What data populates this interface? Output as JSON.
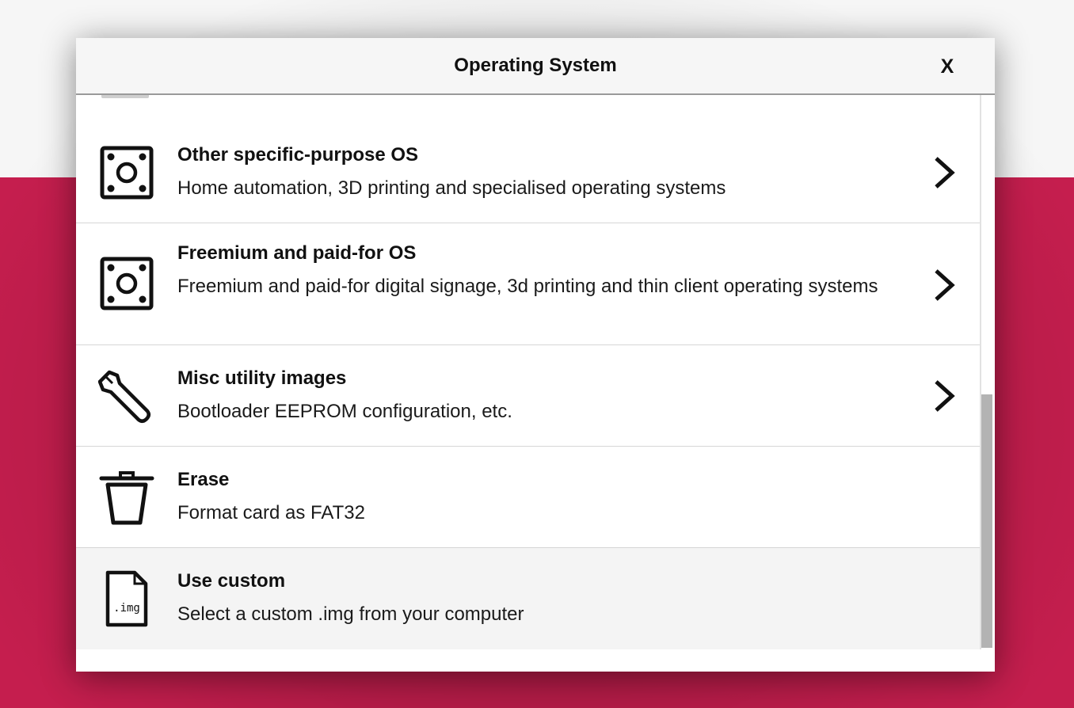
{
  "dialog": {
    "title": "Operating System",
    "close_label": "X"
  },
  "items": [
    {
      "icon": "board-icon",
      "title": "Other specific-purpose OS",
      "description": "Home automation, 3D printing and specialised operating systems",
      "has_submenu": true
    },
    {
      "icon": "board-icon",
      "title": "Freemium and paid-for OS",
      "description": "Freemium and paid-for digital signage, 3d printing and thin client operating systems",
      "has_submenu": true
    },
    {
      "icon": "wrench-icon",
      "title": "Misc utility images",
      "description": "Bootloader EEPROM configuration, etc.",
      "has_submenu": true
    },
    {
      "icon": "trash-icon",
      "title": "Erase",
      "description": "Format card as FAT32",
      "has_submenu": false
    },
    {
      "icon": "img-file-icon",
      "title": "Use custom",
      "description": "Select a custom .img from your computer",
      "has_submenu": false,
      "icon_text": ".img"
    }
  ],
  "colors": {
    "accent": "#c51e4e",
    "header_bg": "#f6f6f6",
    "highlight_bg": "#f4f4f4",
    "scrollbar_thumb": "#b3b3b3"
  }
}
